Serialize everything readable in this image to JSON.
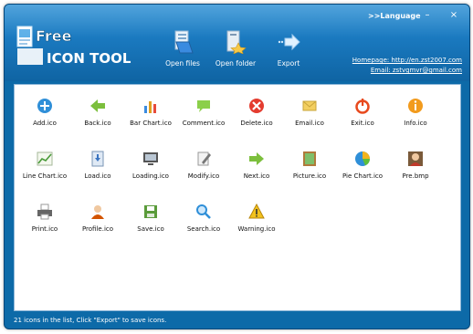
{
  "header": {
    "language_label": ">>Language",
    "minimize": "–",
    "close": "×",
    "logo_line1": "Free",
    "logo_line2": "ICON TOOL",
    "homepage_link": "Homepage: http://en.zst2007.com",
    "email_link": "Email: zstvgmvr@gmail.com"
  },
  "toolbar": {
    "open_files": "Open files",
    "open_folder": "Open folder",
    "export": "Export"
  },
  "icons": [
    {
      "label": "Add.ico",
      "icon": "add-icon",
      "color": "#2f8fd8"
    },
    {
      "label": "Back.ico",
      "icon": "back-arrow-icon",
      "color": "#7cbf3d"
    },
    {
      "label": "Bar Chart.ico",
      "icon": "bar-chart-icon",
      "color": "#e0a020"
    },
    {
      "label": "Comment.ico",
      "icon": "comment-icon",
      "color": "#8bcf4a"
    },
    {
      "label": "Delete.ico",
      "icon": "delete-icon",
      "color": "#e43c2f"
    },
    {
      "label": "Email.ico",
      "icon": "email-icon",
      "color": "#f3cf60"
    },
    {
      "label": "Exit.ico",
      "icon": "exit-icon",
      "color": "#e84a1e"
    },
    {
      "label": "Info.ico",
      "icon": "info-icon",
      "color": "#f29b1d"
    },
    {
      "label": "Line Chart.ico",
      "icon": "line-chart-icon",
      "color": "#4a9b3a"
    },
    {
      "label": "Load.ico",
      "icon": "load-icon",
      "color": "#3a74c0"
    },
    {
      "label": "Loading.ico",
      "icon": "loading-icon",
      "color": "#555555"
    },
    {
      "label": "Modify.ico",
      "icon": "modify-icon",
      "color": "#777777"
    },
    {
      "label": "Next.ico",
      "icon": "next-arrow-icon",
      "color": "#7cbf3d"
    },
    {
      "label": "Picture.ico",
      "icon": "picture-icon",
      "color": "#b07a3a"
    },
    {
      "label": "Pie Chart.ico",
      "icon": "pie-chart-icon",
      "color": "#2f8fd8"
    },
    {
      "label": "Pre.bmp",
      "icon": "person-photo-icon",
      "color": "#c0392b"
    },
    {
      "label": "Print.ico",
      "icon": "print-icon",
      "color": "#666666"
    },
    {
      "label": "Profile.ico",
      "icon": "profile-icon",
      "color": "#d35400"
    },
    {
      "label": "Save.ico",
      "icon": "save-icon",
      "color": "#5a9b3a"
    },
    {
      "label": "Search.ico",
      "icon": "search-icon",
      "color": "#2f8fd8"
    },
    {
      "label": "Warning.ico",
      "icon": "warning-icon",
      "color": "#f2c21d"
    }
  ],
  "status": "21 icons in the list, Click \"Export\" to save icons.",
  "colors": {
    "window": "#0d6aa8",
    "header": "#1a79bf",
    "content_bg": "#ffffff"
  }
}
